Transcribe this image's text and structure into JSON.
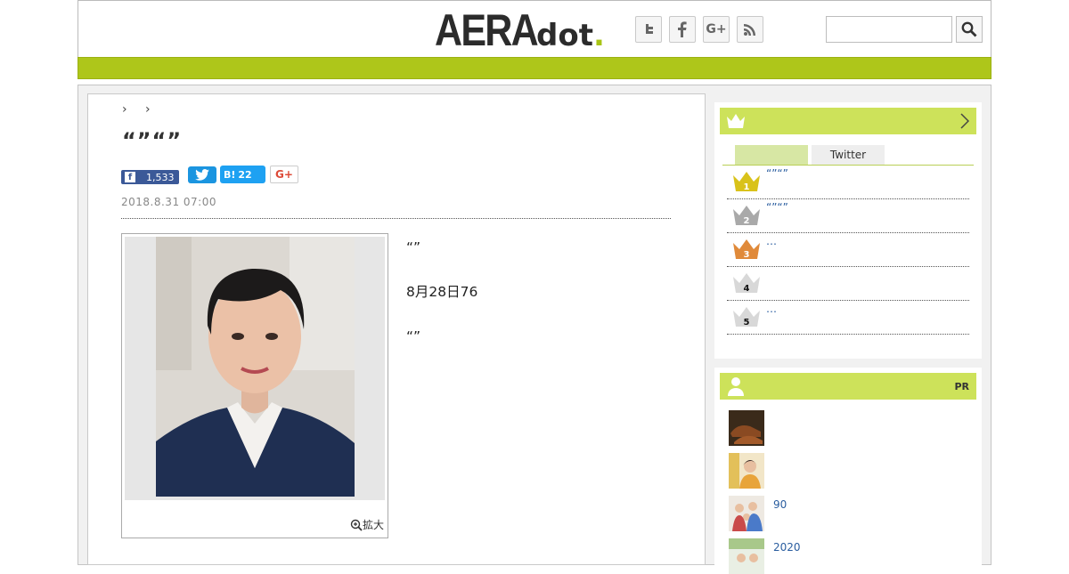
{
  "header": {
    "logo_main": "AERA",
    "logo_sub": "dot",
    "logo_period": ".",
    "social": [
      {
        "name": "twitter-icon",
        "glyph": "t"
      },
      {
        "name": "facebook-icon",
        "glyph": "f"
      },
      {
        "name": "google-plus-icon",
        "glyph": "G+"
      },
      {
        "name": "rss-icon",
        "glyph": "rss"
      }
    ],
    "search_value": ""
  },
  "article": {
    "breadcrumb": "› ›",
    "title": "“”“”",
    "share": {
      "facebook_count": "1,533",
      "hatena_label": "B!",
      "hatena_count": "22",
      "gplus_label": "G+"
    },
    "date": "2018.8.31 07:00",
    "zoom_label": "拡大",
    "paragraphs": [
      "“”",
      "8月28日76",
      "“”",
      "",
      ""
    ]
  },
  "ranking": {
    "tabs": [
      "",
      "Twitter"
    ],
    "items": [
      {
        "rank": "1",
        "text": "“”“”",
        "color": "#d9c21a"
      },
      {
        "rank": "2",
        "text": "“”“”",
        "color": "#a9a9a9"
      },
      {
        "rank": "3",
        "text": "…",
        "color": "#e08a3a"
      },
      {
        "rank": "4",
        "text": "",
        "color": "#d8d8d8"
      },
      {
        "rank": "5",
        "text": "…",
        "color": "#d8d8d8"
      }
    ]
  },
  "pr": {
    "label": "PR",
    "items": [
      {
        "text": ""
      },
      {
        "text": ""
      },
      {
        "text": "90"
      },
      {
        "text": "2020"
      }
    ]
  },
  "colors": {
    "accent_green": "#aec61a",
    "sidebar_bar": "#cde25a",
    "link_blue": "#2a5d9f"
  }
}
